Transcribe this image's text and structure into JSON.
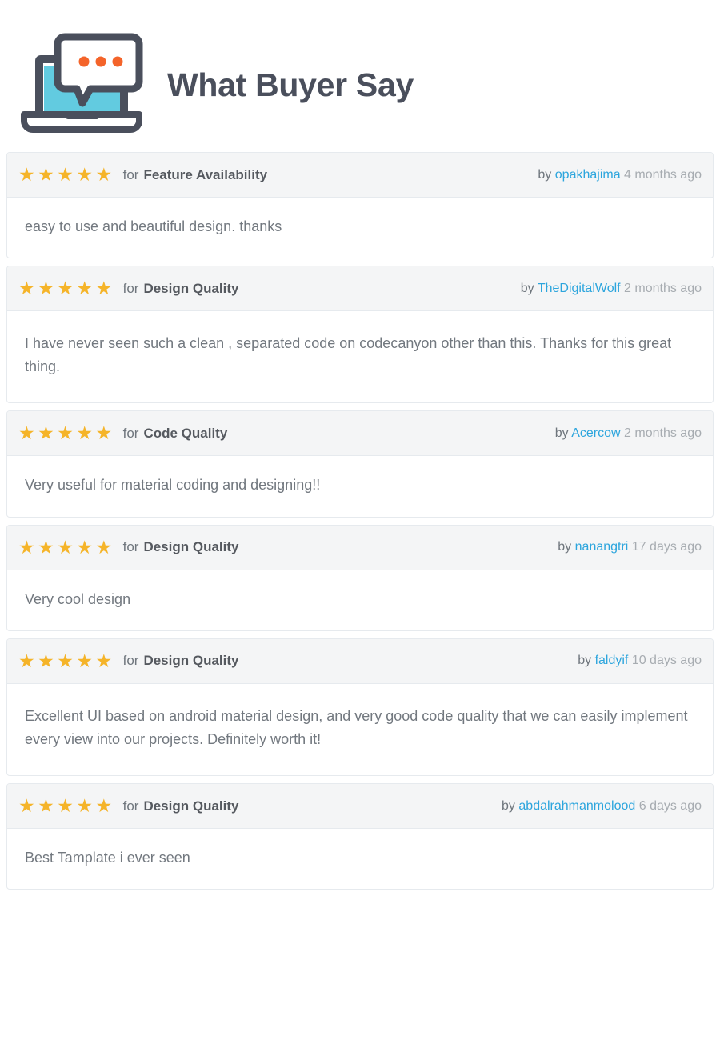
{
  "header": {
    "title": "What Buyer Say",
    "logo_icon": "laptop-chat-bubble-icon",
    "colors": {
      "logo_dark": "#4a4f5c",
      "logo_screen": "#62cbe0",
      "logo_dots": "#f4642a",
      "title": "#4a4f5c"
    }
  },
  "theme": {
    "star_color": "#f5b429",
    "link_color": "#2ca5dd",
    "header_bg": "#f4f5f6",
    "card_border": "#e6eaee",
    "body_text": "#72787f"
  },
  "reviews": [
    {
      "stars": "★★★★★",
      "rating": 5,
      "for_label": "for",
      "criteria": "Feature Availability",
      "by_label": "by",
      "author": "opakhajima",
      "when": "4 months ago",
      "text": "easy to use and beautiful design. thanks"
    },
    {
      "stars": "★★★★★",
      "rating": 5,
      "for_label": "for",
      "criteria": "Design Quality",
      "by_label": "by",
      "author": "TheDigitalWolf",
      "when": "2 months ago",
      "text": "I have never seen such a clean , separated code on codecanyon other than this. Thanks for this great thing."
    },
    {
      "stars": "★★★★★",
      "rating": 5,
      "for_label": "for",
      "criteria": "Code Quality",
      "by_label": "by",
      "author": "Acercow",
      "when": "2 months ago",
      "text": "Very useful for material coding and designing!!"
    },
    {
      "stars": "★★★★★",
      "rating": 5,
      "for_label": "for",
      "criteria": "Design Quality",
      "by_label": "by",
      "author": "nanangtri",
      "when": "17 days ago",
      "text": "Very cool design"
    },
    {
      "stars": "★★★★★",
      "rating": 5,
      "for_label": "for",
      "criteria": "Design Quality",
      "by_label": "by",
      "author": "faldyif",
      "when": "10 days ago",
      "text": "Excellent UI based on android material design, and very good code quality that we can easily implement every view into our projects. Definitely worth it!"
    },
    {
      "stars": "★★★★★",
      "rating": 5,
      "for_label": "for",
      "criteria": "Design Quality",
      "by_label": "by",
      "author": "abdalrahmanmolood",
      "when": "6 days ago",
      "text": "Best Tamplate i ever seen"
    }
  ]
}
